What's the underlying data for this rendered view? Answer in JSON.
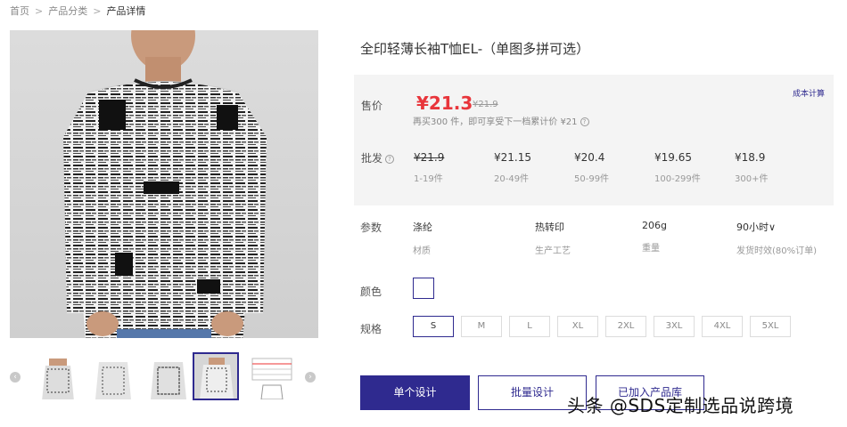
{
  "breadcrumb": {
    "home": "首页",
    "category": "产品分类",
    "current": "产品详情",
    "separator": ">"
  },
  "product": {
    "title": "全印轻薄长袖T恤EL-（单图多拼可选）"
  },
  "price": {
    "label": "售价",
    "current": "¥21.3",
    "original": "¥21.9",
    "note": "再买300 件，即可享受下一档累计价 ¥21",
    "cost_link": "成本计算"
  },
  "wholesale": {
    "label": "批发",
    "tiers": [
      {
        "price": "¥21.9",
        "range": "1-19件"
      },
      {
        "price": "¥21.15",
        "range": "20-49件"
      },
      {
        "price": "¥20.4",
        "range": "50-99件"
      },
      {
        "price": "¥19.65",
        "range": "100-299件"
      },
      {
        "price": "¥18.9",
        "range": "300+件"
      }
    ]
  },
  "params": {
    "label": "参数",
    "items": [
      {
        "value": "涤纶",
        "key": "材质"
      },
      {
        "value": "热转印",
        "key": "生产工艺"
      },
      {
        "value": "206g",
        "key": "重量"
      },
      {
        "value": "90小时∨",
        "key": "发货时效(80%订单)"
      }
    ]
  },
  "color": {
    "label": "颜色",
    "selected": "white"
  },
  "size": {
    "label": "规格",
    "options": [
      "S",
      "M",
      "L",
      "XL",
      "2XL",
      "3XL",
      "4XL",
      "5XL"
    ],
    "selected": "S"
  },
  "actions": {
    "single": "单个设计",
    "batch": "批量设计",
    "added": "已加入产品库"
  },
  "watermark": "头条 @SDS定制选品说跨境",
  "thumbnails": {
    "prev": "‹",
    "next": "›"
  },
  "colors": {
    "accent": "#2f2a8f",
    "price_red": "#e8353b",
    "panel_bg": "#f4f4f4"
  }
}
